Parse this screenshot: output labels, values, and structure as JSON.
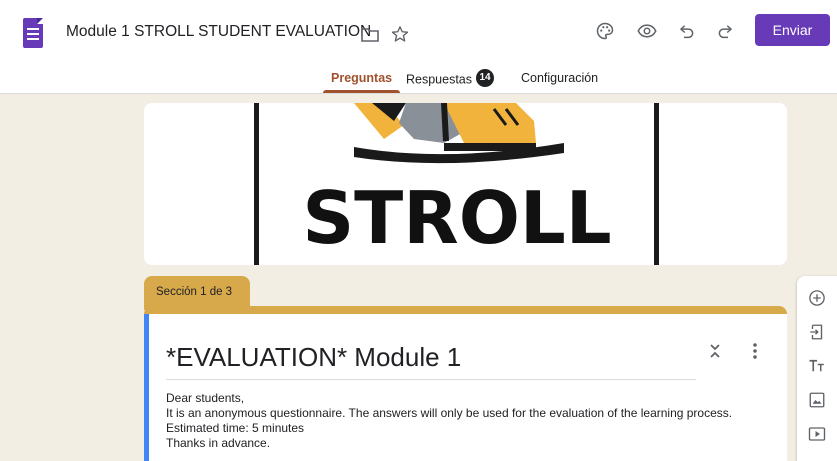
{
  "header": {
    "title": "Module 1 STROLL STUDENT EVALUATION",
    "send_label": "Enviar",
    "icons": [
      "forms-logo-icon",
      "folder-icon",
      "star-icon",
      "palette-icon",
      "preview-eye-icon",
      "undo-icon",
      "redo-icon"
    ]
  },
  "tabs": [
    {
      "label": "Preguntas",
      "active": true
    },
    {
      "label": "Respuestas",
      "badge": "14"
    },
    {
      "label": "Configuración"
    }
  ],
  "hero": {
    "logo_text": "STROLL"
  },
  "section": {
    "label": "Sección 1 de 3",
    "title": "*EVALUATION* Module 1",
    "description": [
      "Dear students,",
      "It is an anonymous questionnaire. The answers will only be used for the evaluation of the learning process.",
      "Estimated time: 5 minutes",
      "Thanks in advance."
    ]
  },
  "side_toolbar": {
    "icons": [
      "add-question-icon",
      "import-questions-icon",
      "add-title-icon",
      "add-image-icon",
      "add-video-icon"
    ]
  },
  "colors": {
    "accent": "#673ab7",
    "theme": "#d7a94b",
    "background": "#f3eee3",
    "active_tab": "#a0522d",
    "focus_bar": "#4285f4"
  }
}
